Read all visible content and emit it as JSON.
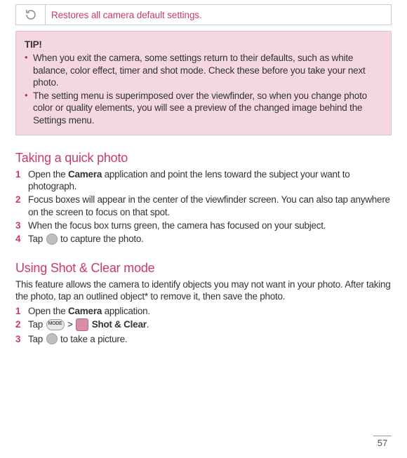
{
  "setting_row": {
    "description": "Restores all camera default settings."
  },
  "tip": {
    "title": "TIP!",
    "items": [
      "When you exit the camera, some settings return to their defaults, such as white balance, color effect, timer and shot mode. Check these before you take your next photo.",
      "The setting menu is superimposed over the viewfinder, so when you change photo color or quality elements, you will see a preview of the changed image behind the Settings menu."
    ]
  },
  "section_quick": {
    "heading": "Taking a quick photo",
    "steps": [
      {
        "pre": "Open the ",
        "bold": "Camera",
        "post": " application and point the lens toward the subject your want to photograph."
      },
      {
        "text": "Focus boxes will appear in the center of the viewfinder screen. You can also tap anywhere on the screen to focus on that spot."
      },
      {
        "text": "When the focus box turns green, the camera has focused on your subject."
      },
      {
        "pre": "Tap ",
        "post": " to capture the photo.",
        "icon": "capture"
      }
    ]
  },
  "section_shotclear": {
    "heading": "Using Shot & Clear mode",
    "intro": "This feature allows the camera to identify objects you may not want in your photo. After taking the photo, tap an outlined object* to remove it, then save the photo.",
    "steps": [
      {
        "pre": "Open the ",
        "bold": "Camera",
        "post": " application."
      },
      {
        "compound": true,
        "pre": "Tap ",
        "mode_label": "MODE",
        "gt": " > ",
        "bold": "Shot & Clear",
        "post": "."
      },
      {
        "pre": "Tap ",
        "post": " to take a picture.",
        "icon": "capture"
      }
    ]
  },
  "page_number": "57"
}
